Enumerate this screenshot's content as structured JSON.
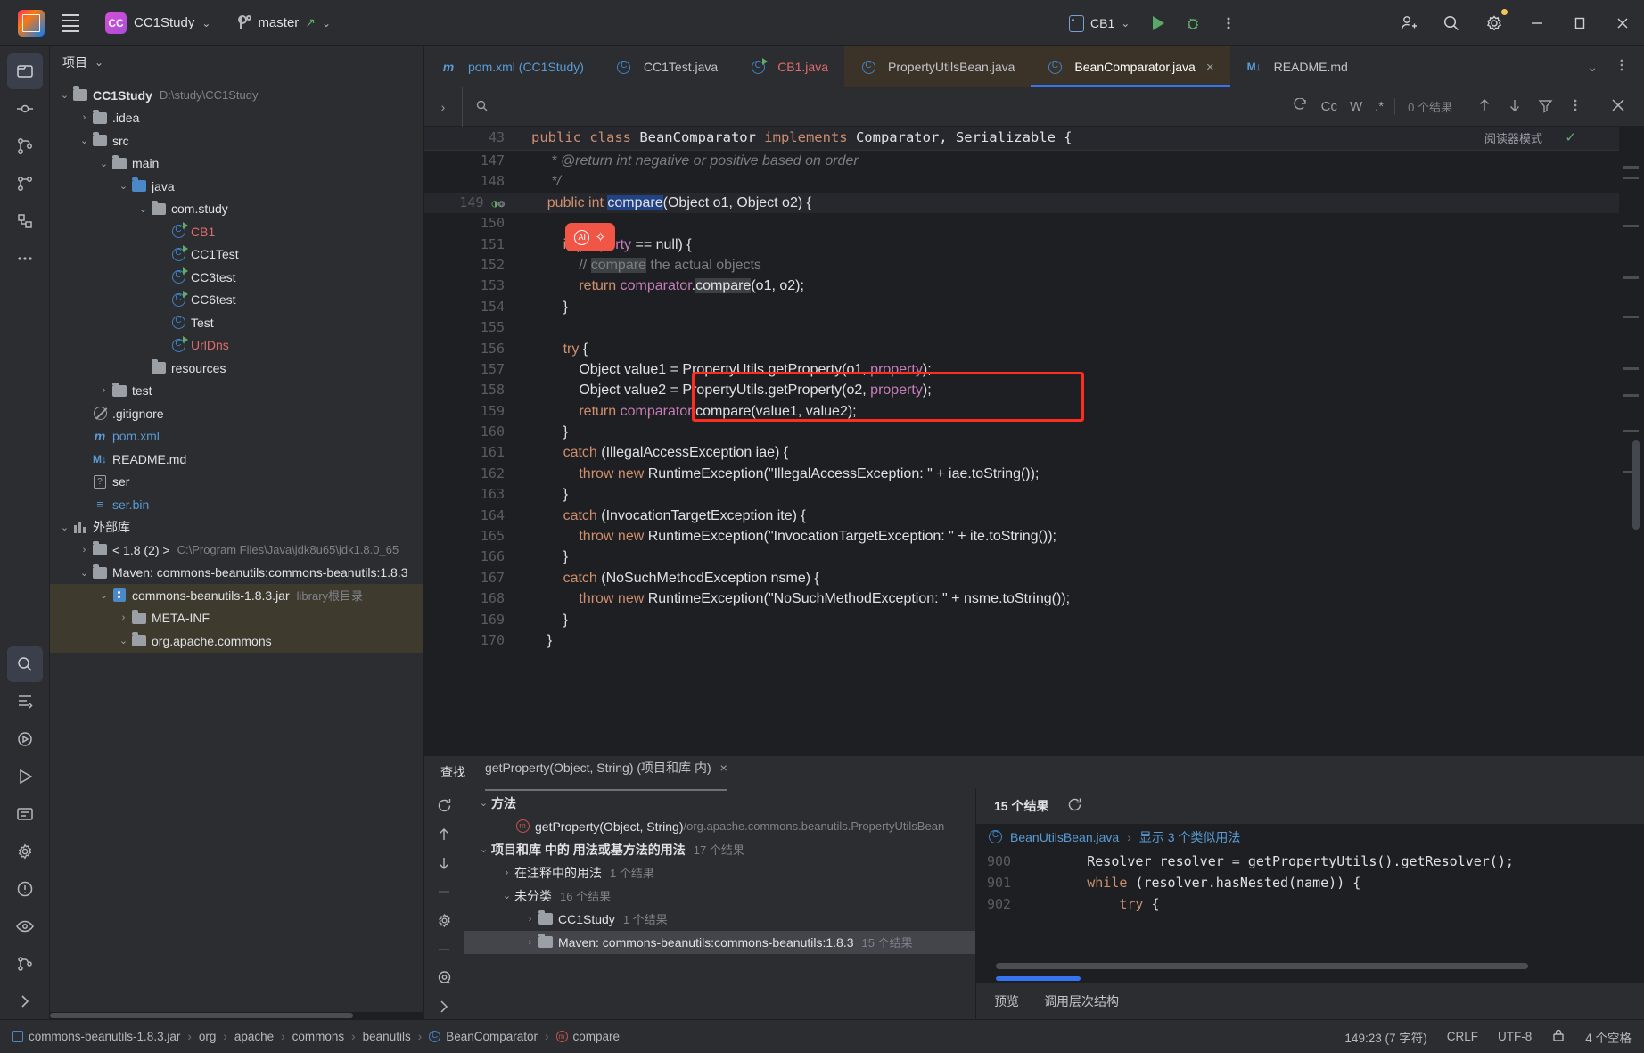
{
  "titlebar": {
    "app_icon": "intellij-idea-logo",
    "menu_icon": "hamburger-menu-icon",
    "project_badge": "CC",
    "project_name": "CC1Study",
    "branch_name": "master",
    "run_config": "CB1",
    "icons": [
      "run-icon",
      "debug-icon",
      "more-actions-icon",
      "add-collaborator-icon",
      "search-everywhere-icon",
      "settings-icon"
    ],
    "window_controls": [
      "minimize",
      "maximize",
      "close"
    ]
  },
  "rail": {
    "items": [
      "project-icon",
      "commit-icon",
      "pull-requests-icon",
      "branches-icon",
      "structure-icon",
      "more-tools-icon",
      "search-icon",
      "terminal-icon",
      "services-icon",
      "run-icon",
      "todo-icon",
      "problems-icon",
      "preview-icon",
      "git-icon",
      "expand-icon"
    ]
  },
  "project_panel": {
    "title": "项目",
    "tree": [
      {
        "depth": 0,
        "arrow": "v",
        "icon": "module-icon",
        "label": "CC1Study",
        "bold": true,
        "sub": "D:\\study\\CC1Study"
      },
      {
        "depth": 1,
        "arrow": ">",
        "icon": "folder-icon",
        "label": ".idea"
      },
      {
        "depth": 1,
        "arrow": "v",
        "icon": "folder-icon",
        "label": "src"
      },
      {
        "depth": 2,
        "arrow": "v",
        "icon": "folder-icon",
        "label": "main"
      },
      {
        "depth": 3,
        "arrow": "v",
        "icon": "source-folder-icon",
        "label": "java",
        "color": "blue-folder"
      },
      {
        "depth": 4,
        "arrow": "v",
        "icon": "package-icon",
        "label": "com.study"
      },
      {
        "depth": 5,
        "arrow": "",
        "icon": "class-runnable-icon",
        "label": "CB1",
        "color": "red"
      },
      {
        "depth": 5,
        "arrow": "",
        "icon": "class-runnable-icon",
        "label": "CC1Test"
      },
      {
        "depth": 5,
        "arrow": "",
        "icon": "class-runnable-icon",
        "label": "CC3test"
      },
      {
        "depth": 5,
        "arrow": "",
        "icon": "class-runnable-icon",
        "label": "CC6test"
      },
      {
        "depth": 5,
        "arrow": "",
        "icon": "class-icon",
        "label": "Test"
      },
      {
        "depth": 5,
        "arrow": "",
        "icon": "class-runnable-icon",
        "label": "UrlDns",
        "color": "red"
      },
      {
        "depth": 4,
        "arrow": "",
        "icon": "resources-folder-icon",
        "label": "resources"
      },
      {
        "depth": 2,
        "arrow": ">",
        "icon": "folder-icon",
        "label": "test"
      },
      {
        "depth": 1,
        "arrow": "",
        "icon": "gitignore-icon",
        "label": ".gitignore"
      },
      {
        "depth": 1,
        "arrow": "",
        "icon": "maven-icon",
        "label": "pom.xml",
        "color": "blue"
      },
      {
        "depth": 1,
        "arrow": "",
        "icon": "markdown-icon",
        "label": "README.md"
      },
      {
        "depth": 1,
        "arrow": "",
        "icon": "unknown-file-icon",
        "label": "ser"
      },
      {
        "depth": 1,
        "arrow": "",
        "icon": "binary-file-icon",
        "label": "ser.bin",
        "color": "blue"
      },
      {
        "depth": 0,
        "arrow": "v",
        "icon": "external-libraries-icon",
        "label": "外部库"
      },
      {
        "depth": 1,
        "arrow": ">",
        "icon": "jdk-icon",
        "label": "< 1.8 (2) >",
        "sub": "C:\\Program Files\\Java\\jdk8u65\\jdk1.8.0_65"
      },
      {
        "depth": 1,
        "arrow": "v",
        "icon": "library-icon",
        "label": "Maven: commons-beanutils:commons-beanutils:1.8.3"
      },
      {
        "depth": 2,
        "arrow": "v",
        "icon": "jar-icon",
        "label": "commons-beanutils-1.8.3.jar",
        "sub": "library根目录",
        "selected": true
      },
      {
        "depth": 3,
        "arrow": ">",
        "icon": "folder-icon",
        "label": "META-INF",
        "selected": true
      },
      {
        "depth": 3,
        "arrow": "v",
        "icon": "folder-icon",
        "label": "org.apache.commons",
        "selected": true
      }
    ]
  },
  "editor": {
    "tabs": [
      {
        "label": "pom.xml (CC1Study)",
        "icon": "maven-icon",
        "color": "blue",
        "active": false
      },
      {
        "label": "CC1Test.java",
        "icon": "class-icon",
        "active": false
      },
      {
        "label": "CB1.java",
        "icon": "class-runnable-icon",
        "color": "red",
        "active": false
      },
      {
        "label": "PropertyUtilsBean.java",
        "icon": "class-icon",
        "active": false,
        "hot": true
      },
      {
        "label": "BeanComparator.java",
        "icon": "class-icon",
        "active": true,
        "closable": true
      },
      {
        "label": "README.md",
        "icon": "markdown-icon",
        "active": false
      }
    ],
    "tabs_overflow": [
      "chevron-down-icon",
      "more-options-icon"
    ],
    "findbar": {
      "placeholder": "",
      "value": "",
      "search_icon": "search-icon",
      "toggles": [
        "regex-history-icon",
        "Cc",
        "W",
        ".*"
      ],
      "result_count": "0 个结果",
      "actions": [
        "prev-match-icon",
        "next-match-icon",
        "filter-icon",
        "more-icon",
        "close-icon"
      ]
    },
    "sticky_header": "public class BeanComparator implements Comparator, Serializable {",
    "sticky_line_number": "43",
    "reader_mode": "阅读器模式",
    "lines": [
      {
        "n": "147",
        "text": "     * @return int negative or positive based on order",
        "type": "javadoc"
      },
      {
        "n": "148",
        "text": "     */",
        "type": "javadoc"
      },
      {
        "n": "149",
        "text": "    public int compare(Object o1, Object o2) {",
        "type": "code",
        "current": true,
        "gutter_icons": [
          "override-icon",
          "usage-icon"
        ]
      },
      {
        "n": "150",
        "text": "",
        "type": "code"
      },
      {
        "n": "151",
        "text": "        if (property == null) {",
        "type": "code"
      },
      {
        "n": "152",
        "text": "            // compare the actual objects",
        "type": "comment"
      },
      {
        "n": "153",
        "text": "            return comparator.compare(o1, o2);",
        "type": "code"
      },
      {
        "n": "154",
        "text": "        }",
        "type": "code"
      },
      {
        "n": "155",
        "text": "",
        "type": "code"
      },
      {
        "n": "156",
        "text": "        try {",
        "type": "code"
      },
      {
        "n": "157",
        "text": "            Object value1 = PropertyUtils.getProperty(o1, property);",
        "type": "code"
      },
      {
        "n": "158",
        "text": "            Object value2 = PropertyUtils.getProperty(o2, property);",
        "type": "code"
      },
      {
        "n": "159",
        "text": "            return comparator.compare(value1, value2);",
        "type": "code"
      },
      {
        "n": "160",
        "text": "        }",
        "type": "code"
      },
      {
        "n": "161",
        "text": "        catch (IllegalAccessException iae) {",
        "type": "code"
      },
      {
        "n": "162",
        "text": "            throw new RuntimeException(\"IllegalAccessException: \" + iae.toString());",
        "type": "code"
      },
      {
        "n": "163",
        "text": "        }",
        "type": "code"
      },
      {
        "n": "164",
        "text": "        catch (InvocationTargetException ite) {",
        "type": "code"
      },
      {
        "n": "165",
        "text": "            throw new RuntimeException(\"InvocationTargetException: \" + ite.toString());",
        "type": "code"
      },
      {
        "n": "166",
        "text": "        }",
        "type": "code"
      },
      {
        "n": "167",
        "text": "        catch (NoSuchMethodException nsme) {",
        "type": "code"
      },
      {
        "n": "168",
        "text": "            throw new RuntimeException(\"NoSuchMethodException: \" + nsme.toString());",
        "type": "code"
      },
      {
        "n": "169",
        "text": "        }",
        "type": "code"
      },
      {
        "n": "170",
        "text": "    }",
        "type": "code"
      }
    ],
    "annotation": {
      "type": "red-rectangle",
      "color": "#ff2d20",
      "covers_lines": [
        "157",
        "158"
      ]
    },
    "ai_badge": {
      "label": "AI",
      "color": "#f05545"
    }
  },
  "find_window": {
    "title": "查找",
    "tab_label": "getProperty(Object, String) (项目和库 内)",
    "tab_close": "×",
    "rail_icons": [
      "rerun-icon",
      "prev-occurrence-icon",
      "next-occurrence-icon",
      "separator",
      "settings-icon",
      "separator",
      "scope-icon",
      "expand-icon"
    ],
    "tree": [
      {
        "depth": 0,
        "arrow": "v",
        "label": "方法",
        "bold": true
      },
      {
        "depth": 1,
        "arrow": "",
        "icon": "method-icon",
        "label": "getProperty(Object, String)",
        "path": "/org.apache.commons.beanutils.PropertyUtilsBean"
      },
      {
        "depth": 0,
        "arrow": "v",
        "label": "项目和库 中的 用法或基方法的用法",
        "count": "17 个结果",
        "bold": true
      },
      {
        "depth": 1,
        "arrow": ">",
        "label": "在注释中的用法",
        "count": "1 个结果"
      },
      {
        "depth": 1,
        "arrow": "v",
        "label": "未分类",
        "count": "16 个结果"
      },
      {
        "depth": 2,
        "arrow": ">",
        "icon": "module-icon",
        "label": "CC1Study",
        "count": "1 个结果"
      },
      {
        "depth": 2,
        "arrow": ">",
        "icon": "library-icon",
        "label": "Maven: commons-beanutils:commons-beanutils:1.8.3",
        "count": "15 个结果",
        "selected": true
      }
    ],
    "preview": {
      "count_label": "15 个结果",
      "refresh_icon": "refresh-icon",
      "file": "BeanUtilsBean.java",
      "similar_link": "显示 3 个类似用法",
      "lines": [
        {
          "n": "900",
          "text": "        Resolver resolver = getPropertyUtils().getResolver();"
        },
        {
          "n": "901",
          "text": "        while (resolver.hasNested(name)) {"
        },
        {
          "n": "902",
          "text": "            try {"
        }
      ],
      "footer_tabs": [
        "预览",
        "调用层次结构"
      ]
    }
  },
  "status_bar": {
    "breadcrumbs": [
      {
        "icon": "jar-icon",
        "label": "commons-beanutils-1.8.3.jar"
      },
      {
        "icon": "",
        "label": "org"
      },
      {
        "icon": "",
        "label": "apache"
      },
      {
        "icon": "",
        "label": "commons"
      },
      {
        "icon": "",
        "label": "beanutils"
      },
      {
        "icon": "class-icon",
        "label": "BeanComparator"
      },
      {
        "icon": "method-icon",
        "label": "compare"
      }
    ],
    "position": "149:23 (7 字符)",
    "line_separator": "CRLF",
    "encoding": "UTF-8",
    "lock_icon": "read-only-icon",
    "indent": "4 个空格"
  }
}
